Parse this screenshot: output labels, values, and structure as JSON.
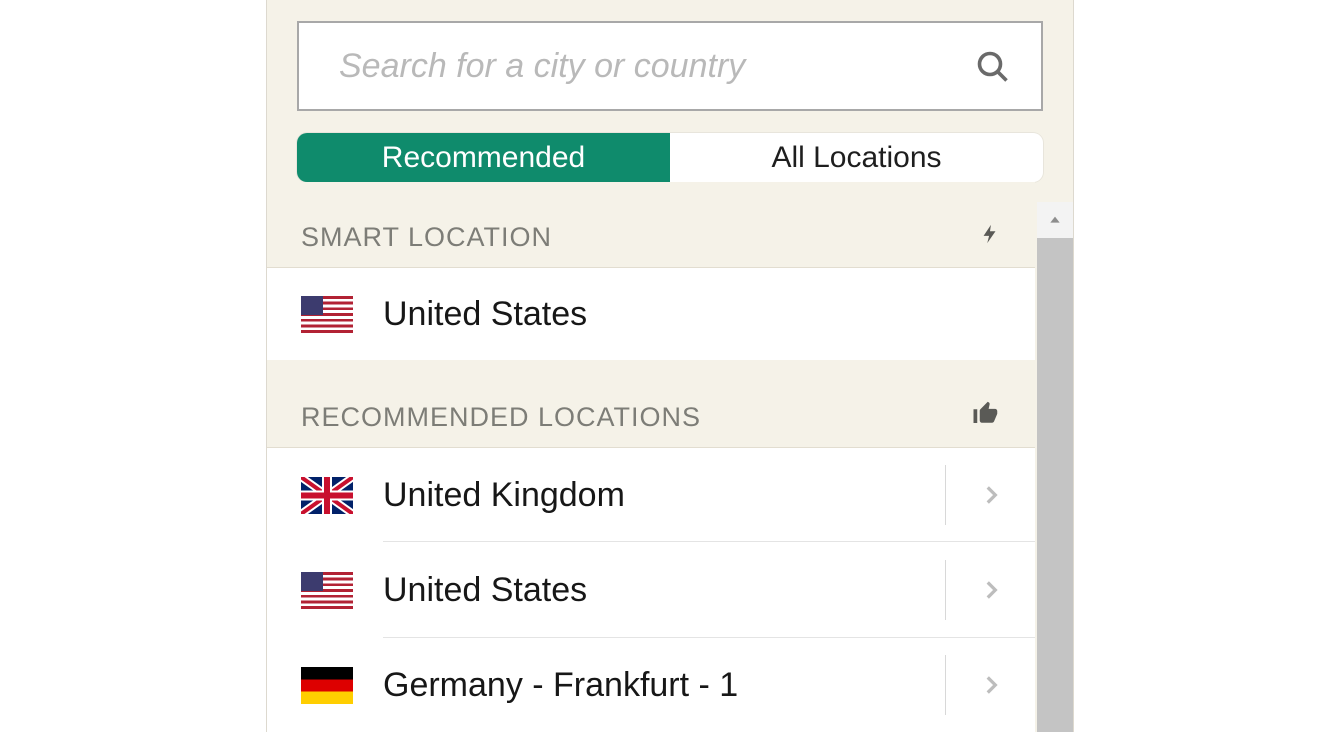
{
  "search": {
    "placeholder": "Search for a city or country"
  },
  "tabs": {
    "recommended": "Recommended",
    "all": "All Locations"
  },
  "sections": {
    "smart": "SMART LOCATION",
    "recommended": "RECOMMENDED LOCATIONS"
  },
  "smart_location": {
    "label": "United States",
    "flag": "us"
  },
  "recommended_locations": [
    {
      "label": "United Kingdom",
      "flag": "uk"
    },
    {
      "label": "United States",
      "flag": "us"
    },
    {
      "label": "Germany - Frankfurt - 1",
      "flag": "de"
    }
  ]
}
